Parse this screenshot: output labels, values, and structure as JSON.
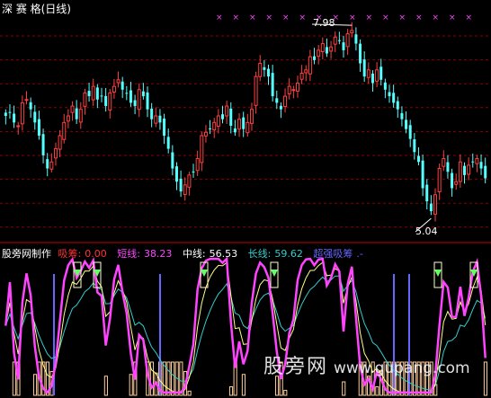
{
  "window": {
    "title": "深 赛 格(日线)"
  },
  "price_panel": {
    "high_label": "7.98",
    "low_label": "5.04"
  },
  "indicator": {
    "name": "股旁网制作",
    "items": [
      {
        "label": "吸筹:",
        "value": "0.00",
        "color": "#ff3333"
      },
      {
        "label": "短线:",
        "value": "38.23",
        "color": "#ff44ff"
      },
      {
        "label": "中线:",
        "value": "56.53",
        "color": "#ffffff"
      },
      {
        "label": "长线:",
        "value": "59.62",
        "color": "#33cccc"
      },
      {
        "label": "超强吸筹",
        "value": ".-",
        "color": "#6666ff"
      }
    ]
  },
  "watermark": {
    "text": "股旁网",
    "url": "www.gupang.com"
  },
  "colors": {
    "up": "#ff4040",
    "down": "#54ffff",
    "grid": "#8b0000",
    "short_line": "#ff44ff",
    "mid_line": "#ffff88",
    "long_line": "#33cccc",
    "buy_signal": "#66ff66"
  },
  "chart_data": {
    "type": "candlestick",
    "y_range": [
      4.7,
      8.2
    ],
    "high": 7.98,
    "low": 5.04,
    "closes": [
      6.6,
      6.65,
      6.5,
      6.45,
      6.8,
      6.85,
      6.7,
      6.5,
      6.3,
      6.0,
      5.8,
      5.9,
      6.1,
      6.3,
      6.5,
      6.6,
      6.75,
      6.55,
      6.7,
      6.95,
      6.9,
      7.05,
      6.85,
      6.9,
      6.75,
      6.95,
      7.05,
      7.15,
      7.0,
      6.95,
      6.8,
      6.75,
      7.0,
      6.9,
      6.7,
      6.55,
      6.6,
      6.5,
      6.3,
      6.1,
      5.8,
      5.6,
      5.45,
      5.55,
      5.7,
      5.75,
      5.95,
      6.3,
      6.35,
      6.4,
      6.5,
      6.6,
      6.55,
      6.75,
      6.45,
      6.35,
      6.55,
      6.4,
      6.5,
      6.7,
      7.2,
      7.4,
      7.3,
      7.2,
      6.9,
      6.8,
      6.7,
      6.9,
      7.05,
      7.0,
      7.1,
      7.25,
      7.3,
      7.5,
      7.45,
      7.6,
      7.7,
      7.55,
      7.65,
      7.8,
      7.75,
      7.6,
      7.85,
      7.9,
      7.7,
      7.4,
      7.2,
      7.3,
      7.1,
      7.3,
      7.15,
      7.0,
      6.9,
      6.8,
      6.7,
      6.55,
      6.4,
      6.25,
      6.05,
      5.9,
      5.5,
      5.3,
      5.15,
      5.4,
      5.8,
      5.95,
      5.75,
      5.5,
      5.6,
      5.9,
      5.7,
      5.85,
      5.9,
      5.95,
      5.8,
      5.65
    ]
  }
}
